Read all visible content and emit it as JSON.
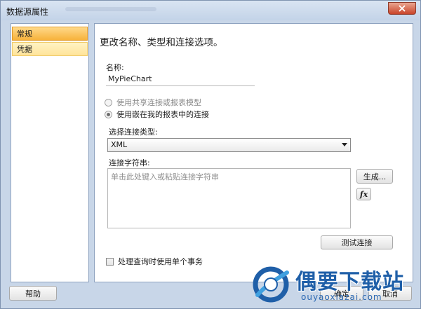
{
  "window": {
    "title": "数据源属性"
  },
  "nav": {
    "items": [
      {
        "label": "常规",
        "active": true
      },
      {
        "label": "凭据",
        "active": false
      }
    ]
  },
  "main": {
    "header": "更改名称、类型和连接选项。",
    "name_label": "名称:",
    "name_value": "MyPieChart",
    "radio_shared": "使用共享连接或报表模型",
    "radio_embedded": "使用嵌在我的报表中的连接",
    "connection_type_label": "选择连接类型:",
    "connection_type_value": "XML",
    "connection_string_label": "连接字符串:",
    "connection_string_placeholder": "单击此处键入或粘贴连接字符串",
    "build_button": "生成...",
    "expression_button": "fx",
    "test_connection_button": "测试连接",
    "single_transaction_label": "处理查询时使用单个事务"
  },
  "footer": {
    "help_button": "帮助",
    "ok_button": "确定",
    "cancel_button": "取消"
  },
  "watermark": {
    "title": "偶要下载站",
    "url": "ouyaoxiazai.com"
  },
  "colors": {
    "nav_active": "#f7b23b",
    "nav_normal": "#ffe49a",
    "window_frame": "#c8d6e8",
    "close_button": "#c9442a",
    "watermark": "#1f5fa8"
  }
}
